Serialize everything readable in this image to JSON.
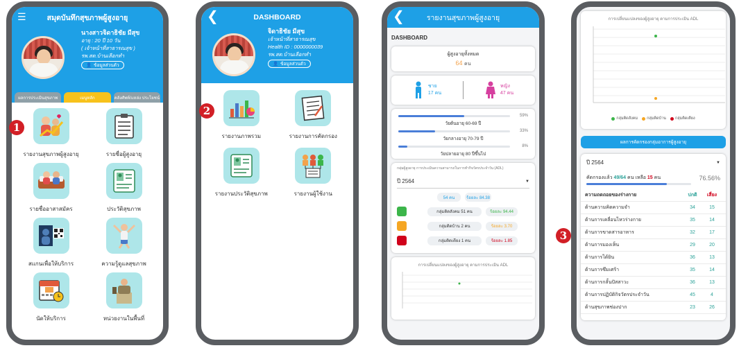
{
  "colors": {
    "primary": "#1ea0e6",
    "marker": "#d21f26",
    "tab_active": "#f7c21c",
    "tile": "#aee6e9",
    "male": "#1ea0e6",
    "female": "#d6409f"
  },
  "markers": [
    "1",
    "2",
    "3"
  ],
  "screen1": {
    "header_title": "สมุดบันทึกสุขภาพผู้สูงอายุ",
    "menu_icon": "hamburger-icon",
    "profile": {
      "name": "นางสาวจิดาธิชัย มีสุข",
      "age": "อายุ : 20 ปี 10 วัน",
      "role": "( เจ้าหน้าที่สาธารณสุข )",
      "hospital": "รพ.สต.บ้านเลือกทำ",
      "button": "ข้อมูลส่วนตัว"
    },
    "tabs": [
      "ผลการประเมินสุขภาพ",
      "เมนูหลัก",
      "คลังศัพท์/แหล่ง ประโยชน์"
    ],
    "menu": [
      {
        "icon": "health-report-icon",
        "label": "รายงานสุขภาพผู้สูงอายุ"
      },
      {
        "icon": "elderly-list-icon",
        "label": "รายชื่อผู้สูงอายุ"
      },
      {
        "icon": "volunteer-list-icon",
        "label": "รายชื่ออาสาสมัคร"
      },
      {
        "icon": "health-history-icon",
        "label": "ประวัติสุขภาพ"
      },
      {
        "icon": "scan-qr-icon",
        "label": "สแกนเพื่อให้บริการ"
      },
      {
        "icon": "health-knowledge-icon",
        "label": "ความรู้ดูแลสุขภาพ"
      },
      {
        "icon": "appointment-calendar-icon",
        "label": "นัดให้บริการ"
      },
      {
        "icon": "field-unit-icon",
        "label": "หน่วยงานในพื้นที่"
      }
    ]
  },
  "screen2": {
    "header_title": "DASHBOARD",
    "back_icon": "back-chevron-icon",
    "profile": {
      "name": "จิดาธิชัย มีสุข",
      "role": "เจ้าหน้าที่สาธารณสุข",
      "health_id": "Health ID : 0000000039",
      "hospital": "รพ.สต.บ้านเลือกทำ",
      "button": "ข้อมูลส่วนตัว"
    },
    "menu": [
      {
        "icon": "overview-report-icon",
        "label": "รายงานภาพรวม"
      },
      {
        "icon": "screening-report-icon",
        "label": "รายงานการคัดกรอง"
      },
      {
        "icon": "health-history-report-icon",
        "label": "รายงานประวัติสุขภาพ"
      },
      {
        "icon": "user-report-icon",
        "label": "รายงานผู้ใช้งาน"
      }
    ]
  },
  "screen3": {
    "header_title": "รายงานสุขภาพผู้สูงอายุ",
    "back_icon": "back-chevron-icon",
    "section": "DASHBOARD",
    "total_label": "ผู้สูงอายุทั้งหมด",
    "total_value": "64",
    "unit": "คน",
    "male_label": "ชาย",
    "male_value": "17",
    "female_label": "หญิง",
    "female_value": "47",
    "age_groups": [
      {
        "label": "วัยต้นอายุ 60-69 ปี",
        "pct": "59%",
        "fill": 0.59
      },
      {
        "label": "วัยกลางอายุ 70-79 ปี",
        "pct": "33%",
        "fill": 0.33
      },
      {
        "label": "วัยปลายอายุ 80 ปีขึ้นไป",
        "pct": "8%",
        "fill": 0.08
      }
    ],
    "adl_note": "กลุ่มผู้สูงอายุ การประเมินความสามารถในการทำกิจวัตรประจำวัน (ADL)",
    "year": "ปี 2564",
    "screened_chip": "54 คน",
    "screened_pct": "ร้อยละ 84.38",
    "groups": [
      {
        "icon": "social-group-icon",
        "label": "กลุ่มติดสังคม 51 คน",
        "pct": "ร้อยละ 94.44"
      },
      {
        "icon": "home-group-icon",
        "label": "กลุ่มติดบ้าน 2 คน",
        "pct": "ร้อยละ 3.70"
      },
      {
        "icon": "bed-group-icon",
        "label": "กลุ่มติดเตียง 1 คน",
        "pct": "ร้อยละ 1.85"
      }
    ],
    "chart_title": "การเปลี่ยนแปลงของผู้สูงอายุ ตามการประเมิน ADL"
  },
  "screen4": {
    "chart_title": "การเปลี่ยนแปลงของผู้สูงอายุ ตามการประเมิน ADL",
    "legend": [
      {
        "label": "กลุ่มติดสังคม",
        "color": "#3cb54a"
      },
      {
        "label": "กลุ่มติดบ้าน",
        "color": "#f5a623"
      },
      {
        "label": "กลุ่มติดเตียง",
        "color": "#d0021b"
      }
    ],
    "screen_button": "ผลการคัดกรองกลุ่มอาการผู้สูงอายุ",
    "year": "ปี 2564",
    "screened_text_a": "คัดกรองแล้ว",
    "screened_count": "49/64",
    "screened_text_b": "คน เหลือ",
    "remaining": "15",
    "unit": "คน",
    "screened_pct": "76.56%",
    "screened_fill": 0.7656,
    "table_headers": [
      "ความถดถอยของร่างกาย",
      "ปกติ",
      "เสี่ยง"
    ],
    "table_rows": [
      [
        "ด้านความคิดความจำ",
        "34",
        "15"
      ],
      [
        "ด้านการเคลื่อนไหวร่างกาย",
        "35",
        "14"
      ],
      [
        "ด้านการขาดสารอาหาร",
        "32",
        "17"
      ],
      [
        "ด้านการมองเห็น",
        "29",
        "20"
      ],
      [
        "ด้านการได้ยิน",
        "36",
        "13"
      ],
      [
        "ด้านการซึมเศร้า",
        "35",
        "14"
      ],
      [
        "ด้านการกลั้นปัสสาวะ",
        "36",
        "13"
      ],
      [
        "ด้านการปฏิบัติกิจวัตรประจำวัน",
        "45",
        "4"
      ],
      [
        "ด้านสุขภาพช่องปาก",
        "23",
        "26"
      ]
    ]
  }
}
